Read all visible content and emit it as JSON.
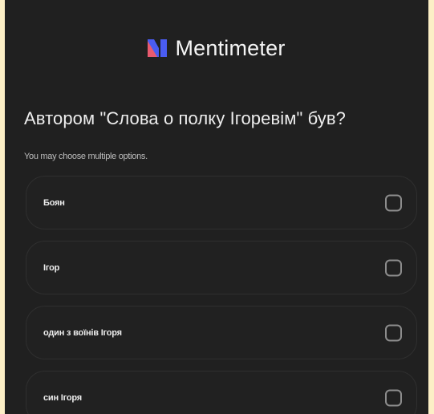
{
  "brand": {
    "name": "Mentimeter",
    "logo_colors": [
      "#4a5cf2",
      "#e85a6e"
    ]
  },
  "question": {
    "title": "Автором \"Слова о полку Ігоревім\" був?",
    "hint": "You may choose multiple options."
  },
  "options": [
    {
      "label": "Боян",
      "checked": false
    },
    {
      "label": "Ігор",
      "checked": false
    },
    {
      "label": "один з воїнів Ігоря",
      "checked": false
    },
    {
      "label": "син Ігоря",
      "checked": false
    }
  ]
}
